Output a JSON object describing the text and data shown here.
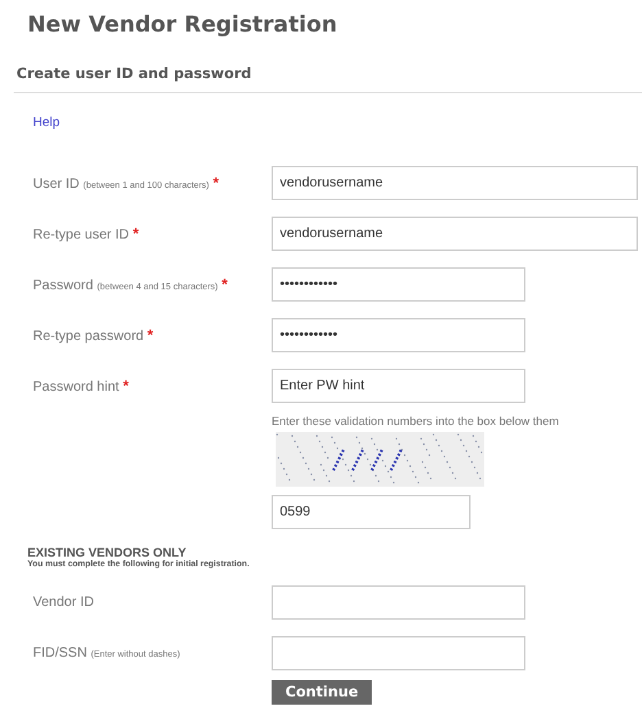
{
  "title": "New Vendor Registration",
  "section": "Create user ID and password",
  "help_link": "Help",
  "fields": [
    {
      "label": "User ID",
      "note": "(between 1 and 100 characters)",
      "required_mark": "*",
      "value": "vendorusername",
      "kind": "wide"
    },
    {
      "label": "Re-type user ID",
      "required_mark": "*",
      "value": "vendorusername",
      "kind": "wide"
    },
    {
      "label": "Password",
      "note": "(between 4 and 15 characters)",
      "required_mark": "*",
      "value": "••••••••••••",
      "kind": "narrow"
    },
    {
      "label": "Re-type password",
      "required_mark": "*",
      "value": "••••••••••••",
      "kind": "narrow"
    },
    {
      "label": "Password hint",
      "required_mark": "*",
      "value": "Enter PW hint",
      "kind": "narrow"
    }
  ],
  "captcha": {
    "instruction": "Enter these validation numbers into the box below them",
    "value": "0599"
  },
  "existing": {
    "heading": "EXISTING VENDORS ONLY",
    "subheading": "You must complete the following for initial registration.",
    "fields": [
      {
        "label": "Vendor ID"
      },
      {
        "label": "FID/SSN",
        "note": "(Enter without dashes)"
      }
    ]
  },
  "button": "Continue"
}
